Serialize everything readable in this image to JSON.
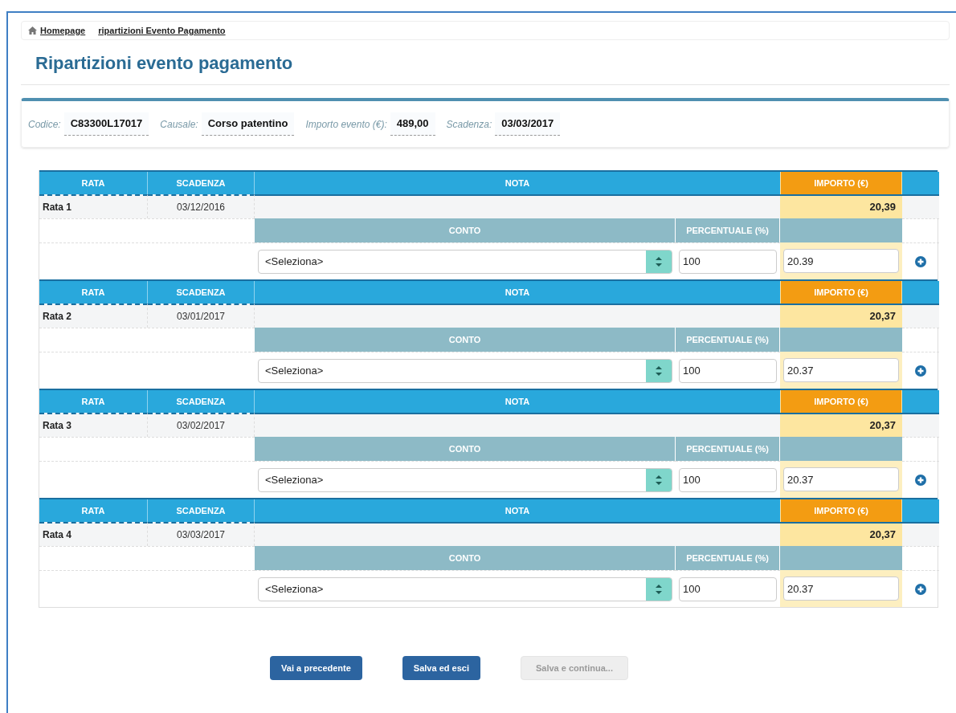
{
  "breadcrumb": [
    "Homepage",
    "ripartizioni Evento Pagamento"
  ],
  "title": "Ripartizioni evento pagamento",
  "summary": [
    {
      "label": "Codice:",
      "value": "C83300L17017"
    },
    {
      "label": "Causale:",
      "value": "Corso patentino"
    },
    {
      "label": "Importo evento (€):",
      "value": "489,00"
    },
    {
      "label": "Scadenza:",
      "value": "03/03/2017"
    }
  ],
  "rate": [
    {
      "headers": {
        "rata": "RATA",
        "scadenza": "SCADENZA",
        "nota": "NOTA",
        "importo": "IMPORTO (€)",
        "conto": "CONTO",
        "percentuale": "PERCENTUALE (%)"
      },
      "rata": "Rata 1",
      "scadenza": "03/12/2016",
      "importo": "20,39",
      "conto": "<Seleziona>",
      "percentuale": "100",
      "importo_input": "20.39"
    },
    {
      "headers": {
        "rata": "RATA",
        "scadenza": "SCADENZA",
        "nota": "NOTA",
        "importo": "IMPORTO (€)",
        "conto": "CONTO",
        "percentuale": "PERCENTUALE (%)"
      },
      "rata": "Rata 2",
      "scadenza": "03/01/2017",
      "importo": "20,37",
      "conto": "<Seleziona>",
      "percentuale": "100",
      "importo_input": "20.37"
    },
    {
      "headers": {
        "rata": "RATA",
        "scadenza": "SCADENZA",
        "nota": "NOTA",
        "importo": "IMPORTO (€)",
        "conto": "CONTO",
        "percentuale": "PERCENTUALE (%)"
      },
      "rata": "Rata 3",
      "scadenza": "03/02/2017",
      "importo": "20,37",
      "conto": "<Seleziona>",
      "percentuale": "100",
      "importo_input": "20.37"
    },
    {
      "headers": {
        "rata": "RATA",
        "scadenza": "SCADENZA",
        "nota": "NOTA",
        "importo": "IMPORTO (€)",
        "conto": "CONTO",
        "percentuale": "PERCENTUALE (%)"
      },
      "rata": "Rata 4",
      "scadenza": "03/03/2017",
      "importo": "20,37",
      "conto": "<Seleziona>",
      "percentuale": "100",
      "importo_input": "20.37"
    }
  ],
  "buttons": [
    {
      "label": "Vai a precedente",
      "disabled": false
    },
    {
      "label": "Salva ed esci",
      "disabled": false
    },
    {
      "label": "Salva e continua...",
      "disabled": true
    }
  ]
}
